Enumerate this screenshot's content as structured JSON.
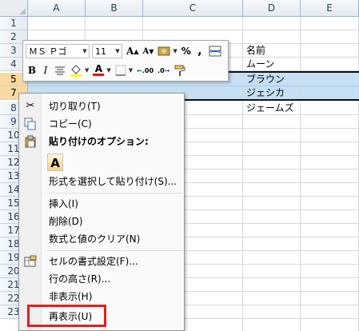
{
  "columns": [
    "A",
    "B",
    "C",
    "D",
    "E"
  ],
  "rows": [
    "1",
    "2",
    "3",
    "4",
    "5",
    "7",
    "8",
    "9",
    "10",
    "11",
    "12",
    "13",
    "14",
    "15",
    "16",
    "17",
    "18",
    "19",
    "20",
    "21",
    "22",
    "23"
  ],
  "cells": {
    "d3": "名前",
    "d4": "ムーン",
    "d5": "ブラウン",
    "d7": "ジェシカ",
    "d8": "ジェームズ"
  },
  "mini_toolbar": {
    "font_name": "ＭＳ Ｐゴ",
    "font_size": "11",
    "grow_font": "A",
    "shrink_font": "A",
    "percent": "%",
    "comma": ",",
    "bold": "B",
    "font_color": "A",
    "increase_decimal": ".00",
    "decrease_decimal": ".0",
    "icons": [
      "grow-font-icon",
      "shrink-font-icon",
      "accounting-format-icon",
      "percent-style-icon",
      "comma-style-icon",
      "merge-center-icon",
      "align-center-icon",
      "fill-color-icon",
      "font-color-icon",
      "borders-icon",
      "increase-decimal-icon",
      "decrease-decimal-icon",
      "format-painter-icon"
    ],
    "colors": {
      "fill": "#ffff00",
      "font": "#ff0000"
    }
  },
  "context_menu": {
    "cut": "切り取り(T)",
    "copy": "コピー(C)",
    "paste_options_header": "貼り付けのオプション:",
    "paste_values_icon": "A",
    "paste_special": "形式を選択して貼り付け(S)...",
    "insert": "挿入(I)",
    "delete": "削除(D)",
    "clear_contents": "数式と値のクリア(N)",
    "format_cells": "セルの書式設定(F)...",
    "row_height": "行の高さ(R)...",
    "hide": "非表示(H)",
    "unhide": "再表示(U)"
  },
  "highlight_color": "#e02020"
}
